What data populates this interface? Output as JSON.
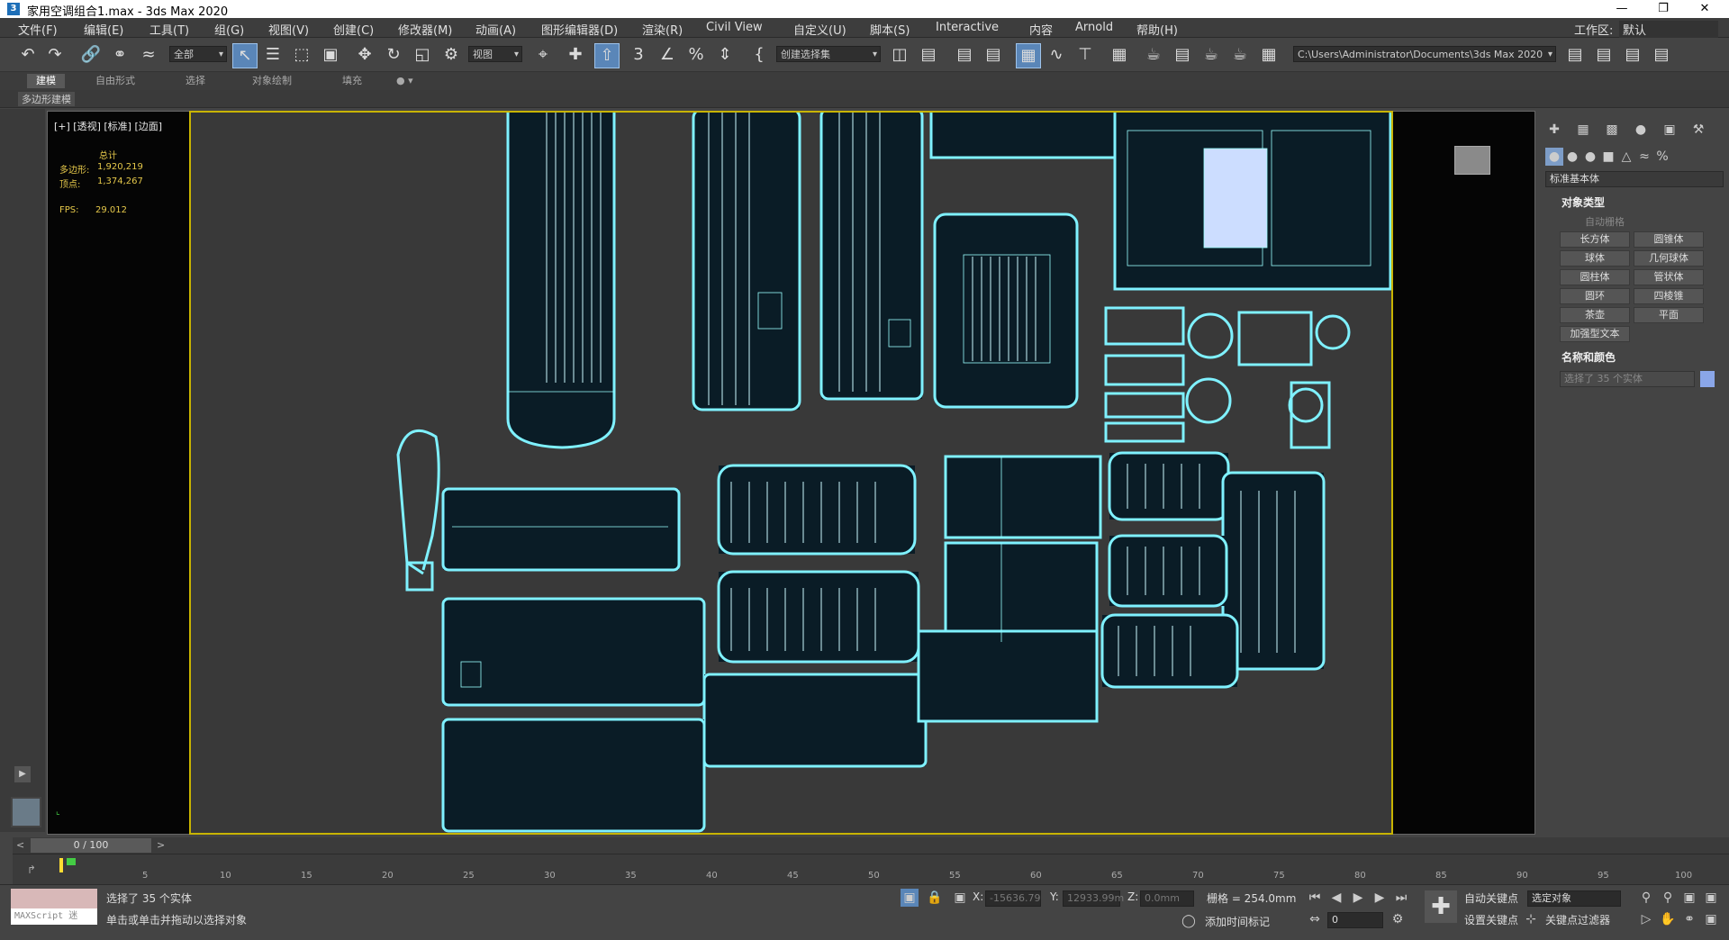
{
  "window": {
    "title": "家用空调组合1.max - 3ds Max 2020",
    "app_icon": "3"
  },
  "menu": [
    "文件(F)",
    "编辑(E)",
    "工具(T)",
    "组(G)",
    "视图(V)",
    "创建(C)",
    "修改器(M)",
    "动画(A)",
    "图形编辑器(D)",
    "渲染(R)",
    "Civil View",
    "自定义(U)",
    "脚本(S)",
    "Interactive",
    "内容",
    "Arnold",
    "帮助(H)"
  ],
  "workspace": {
    "label": "工作区:",
    "value": "默认"
  },
  "toolbar": {
    "filter_dropdown": "全部",
    "refcoord_dropdown": "视图",
    "selection_set": "创建选择集",
    "project_path": "C:\\Users\\Administrator\\Documents\\3ds Max 2020"
  },
  "ribbon": {
    "tabs": [
      "建模",
      "自由形式",
      "选择",
      "对象绘制",
      "填充"
    ],
    "active": "建模",
    "sub_label": "多边形建模"
  },
  "viewport": {
    "label": "[+] [透视] [标准] [边面]",
    "stats": {
      "total_label": "总计",
      "poly_label": "多边形:",
      "poly_value": "1,920,219",
      "vert_label": "顶点:",
      "vert_value": "1,374,267",
      "fps_label": "FPS:",
      "fps_value": "29.012"
    }
  },
  "command_panel": {
    "category_dropdown": "标准基本体",
    "object_type_header": "对象类型",
    "autogrid_label": "自动栅格",
    "buttons": [
      "长方体",
      "圆锥体",
      "球体",
      "几何球体",
      "圆柱体",
      "管状体",
      "圆环",
      "四棱锥",
      "茶壶",
      "平面",
      "加强型文本"
    ],
    "name_color_header": "名称和颜色",
    "name_field": "选择了 35 个实体",
    "swatch_color": "#8aa6e8"
  },
  "timeline": {
    "frame_display": "0 / 100",
    "ticks": [
      "5",
      "10",
      "15",
      "20",
      "25",
      "30",
      "35",
      "40",
      "45",
      "50",
      "55",
      "60",
      "65",
      "70",
      "75",
      "80",
      "85",
      "90",
      "95",
      "100"
    ]
  },
  "status": {
    "maxscript": "MAXScript 迷",
    "selected": "选择了 35 个实体",
    "prompt": "单击或单击并拖动以选择对象",
    "x_label": "X:",
    "x_value": "-15636.79",
    "y_label": "Y:",
    "y_value": "12933.99m",
    "z_label": "Z:",
    "z_value": "0.0mm",
    "grid": "栅格 = 254.0mm",
    "add_time_tag": "添加时间标记",
    "auto_key": "自动关键点",
    "set_key": "设置关键点",
    "selected_obj": "选定对象",
    "key_filters": "关键点过滤器",
    "frame_field": "0"
  }
}
